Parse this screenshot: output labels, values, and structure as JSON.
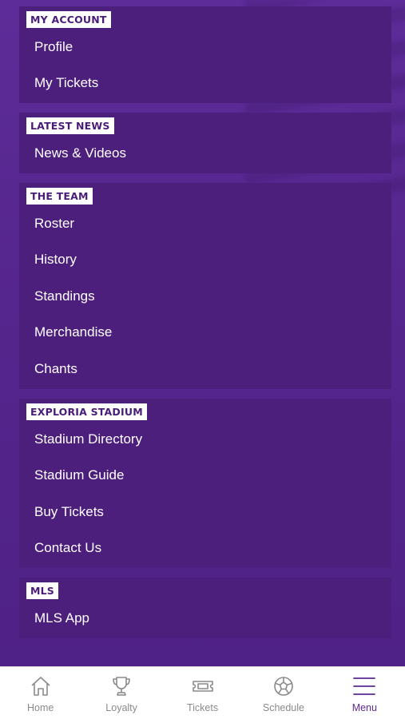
{
  "sections": [
    {
      "tag": "MY ACCOUNT",
      "items": [
        "Profile",
        "My Tickets"
      ]
    },
    {
      "tag": "LATEST NEWS",
      "items": [
        "News & Videos"
      ]
    },
    {
      "tag": "THE TEAM",
      "items": [
        "Roster",
        "History",
        "Standings",
        "Merchandise",
        "Chants"
      ]
    },
    {
      "tag": "EXPLORIA STADIUM",
      "items": [
        "Stadium Directory",
        "Stadium Guide",
        "Buy Tickets",
        "Contact Us"
      ]
    },
    {
      "tag": "MLS",
      "items": [
        "MLS App"
      ]
    }
  ],
  "tabbar": {
    "tabs": [
      {
        "label": "Home",
        "icon": "home-icon"
      },
      {
        "label": "Loyalty",
        "icon": "trophy-icon"
      },
      {
        "label": "Tickets",
        "icon": "ticket-icon"
      },
      {
        "label": "Schedule",
        "icon": "soccer-ball-icon"
      },
      {
        "label": "Menu",
        "icon": "hamburger-menu-icon"
      }
    ],
    "active": "Menu"
  },
  "colors": {
    "background": "#5b2a93",
    "section": "#4d1f7c",
    "active_tab": "#5b2a93",
    "inactive_tab": "#8a8a8a"
  }
}
